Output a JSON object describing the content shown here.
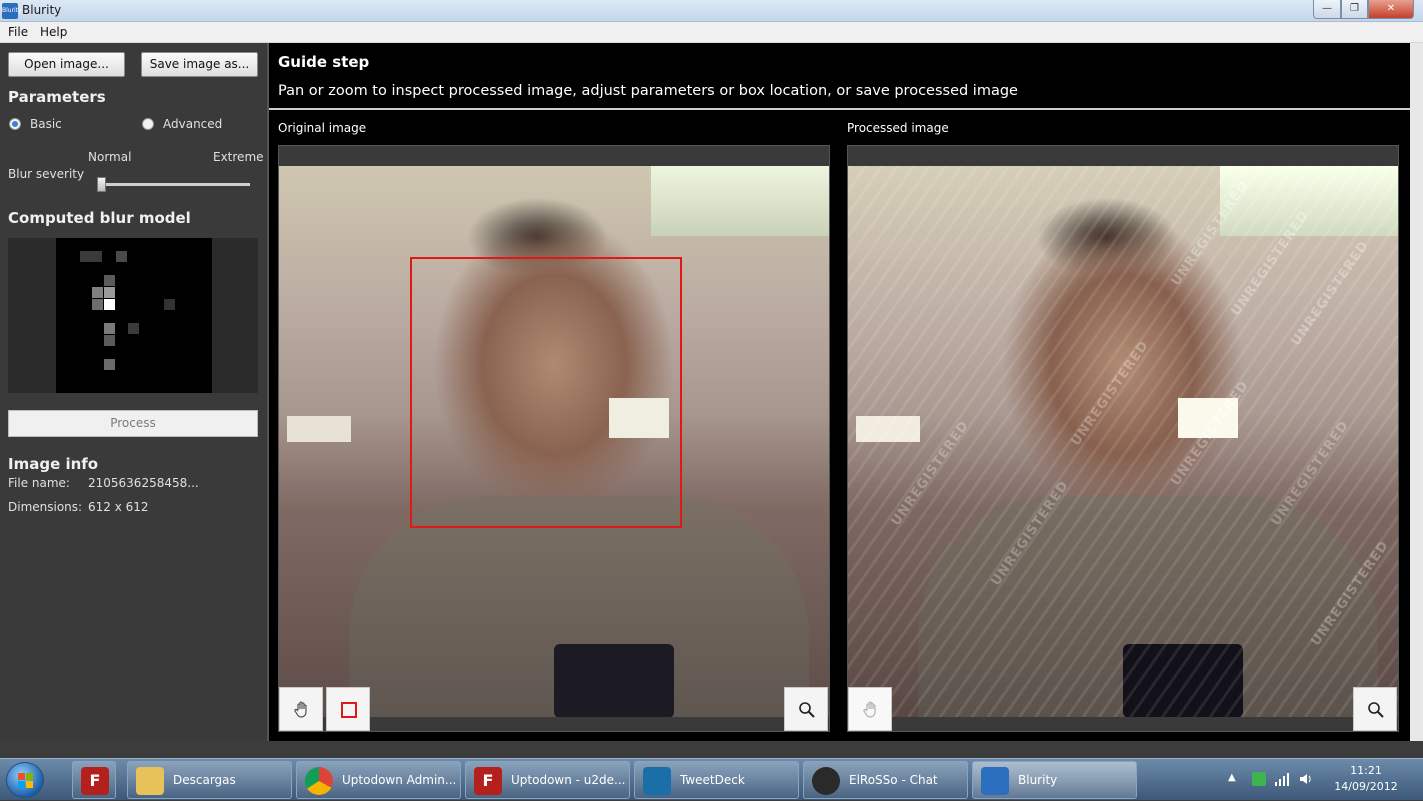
{
  "window": {
    "title": "Blurity",
    "app_icon_text": "Blurity"
  },
  "menu": {
    "file": "File",
    "help": "Help"
  },
  "left": {
    "open_button": "Open image...",
    "save_button": "Save image as...",
    "parameters_title": "Parameters",
    "mode_basic": "Basic",
    "mode_advanced": "Advanced",
    "selected_mode": "Basic",
    "slider_min_label": "Normal",
    "slider_max_label": "Extreme",
    "blur_severity_label": "Blur severity",
    "blur_severity_value": 0.0,
    "blur_model_title": "Computed blur model",
    "process_button": "Process",
    "image_info_title": "Image info",
    "file_name_label": "File name:",
    "file_name_value": "2105636258458...",
    "dimensions_label": "Dimensions:",
    "dimensions_value": "612 x 612"
  },
  "guide": {
    "title": "Guide step",
    "text": "Pan or zoom to inspect processed image, adjust parameters or box location, or save processed image"
  },
  "panels": {
    "original_label": "Original image",
    "processed_label": "Processed image",
    "watermark": "UNREGISTERED"
  },
  "taskbar": {
    "items": [
      {
        "label": "Descargas"
      },
      {
        "label": "Uptodown Admin..."
      },
      {
        "label": "Uptodown - u2de..."
      },
      {
        "label": "TweetDeck"
      },
      {
        "label": "ElRoSSo - Chat"
      },
      {
        "label": "Blurity"
      }
    ],
    "clock_time": "11:21",
    "clock_date": "14/09/2012"
  },
  "colors": {
    "selection_box": "#e01818",
    "accent": "#3b7fd6"
  }
}
